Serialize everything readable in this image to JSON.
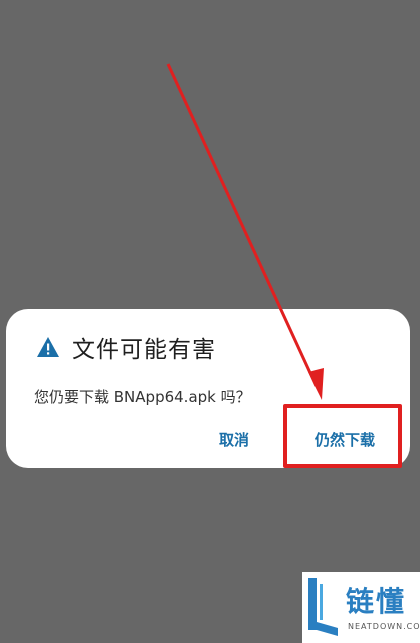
{
  "dialog": {
    "title": "文件可能有害",
    "title_icon": "warning-triangle-icon",
    "message": "您仍要下载 BNApp64.apk 吗？",
    "buttons": {
      "cancel_label": "取消",
      "download_label": "仍然下载"
    },
    "accent_color": "#1b6fa8"
  },
  "annotation": {
    "highlight_color": "#e02020",
    "arrow_icon": "red-arrow-icon"
  },
  "watermark": {
    "text_cn": "链懂",
    "text_en": "NEATDOWN.COM",
    "logo_icon": "neatdown-logo-icon"
  }
}
